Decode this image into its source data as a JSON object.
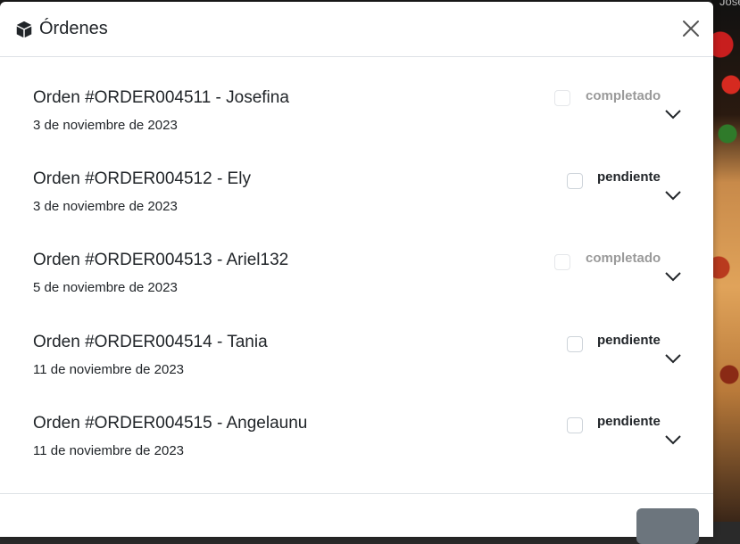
{
  "background": {
    "partial_text": "Josefina"
  },
  "modal": {
    "title": "Órdenes",
    "icon": "box-icon",
    "close_icon": "close-icon"
  },
  "orders": [
    {
      "title": "Orden #ORDER004511 - Josefina",
      "date": "3 de noviembre de 2023",
      "status": "completado",
      "checkbox_disabled": true
    },
    {
      "title": "Orden #ORDER004512 - Ely",
      "date": "3 de noviembre de 2023",
      "status": "pendiente",
      "checkbox_disabled": false
    },
    {
      "title": "Orden #ORDER004513 - Ariel132",
      "date": "5 de noviembre de 2023",
      "status": "completado",
      "checkbox_disabled": true
    },
    {
      "title": "Orden #ORDER004514 - Tania",
      "date": "11 de noviembre de 2023",
      "status": "pendiente",
      "checkbox_disabled": false
    },
    {
      "title": "Orden #ORDER004515 - Angelaunu",
      "date": "11 de noviembre de 2023",
      "status": "pendiente",
      "checkbox_disabled": false
    }
  ]
}
